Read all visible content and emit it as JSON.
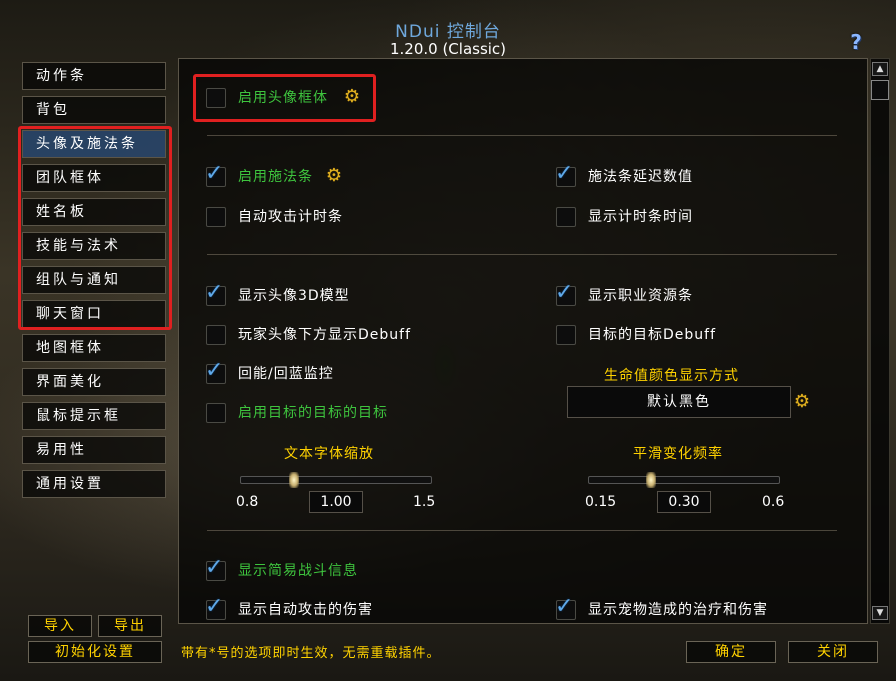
{
  "window": {
    "title": "NDui 控制台",
    "version": "1.20.0 (Classic)"
  },
  "categories": [
    {
      "label": "动作条"
    },
    {
      "label": "背包"
    },
    {
      "label": "头像及施法条"
    },
    {
      "label": "团队框体"
    },
    {
      "label": "姓名板"
    },
    {
      "label": "技能与法术"
    },
    {
      "label": "组队与通知"
    },
    {
      "label": "聊天窗口"
    },
    {
      "label": "地图框体"
    },
    {
      "label": "界面美化"
    },
    {
      "label": "鼠标提示框"
    },
    {
      "label": "易用性"
    },
    {
      "label": "通用设置"
    }
  ],
  "options": {
    "enable_unitframes": {
      "label": "启用头像框体",
      "checked": false
    },
    "enable_castbar": {
      "label": "启用施法条",
      "checked": true
    },
    "castbar_latency": {
      "label": "施法条延迟数值",
      "checked": true
    },
    "swing_timer": {
      "label": "自动攻击计时条",
      "checked": false
    },
    "show_cast_time": {
      "label": "显示计时条时间",
      "checked": false
    },
    "portrait_3d": {
      "label": "显示头像3D模型",
      "checked": true
    },
    "class_power": {
      "label": "显示职业资源条",
      "checked": true
    },
    "player_debuff": {
      "label": "玩家头像下方显示Debuff",
      "checked": false
    },
    "tot_debuff": {
      "label": "目标的目标Debuff",
      "checked": false
    },
    "energy_ticker": {
      "label": "回能/回蓝监控",
      "checked": true
    },
    "tot_of_tot": {
      "label": "启用目标的目标的目标",
      "checked": false
    },
    "simple_combat_text": {
      "label": "显示简易战斗信息",
      "checked": true
    },
    "auto_attack_damage": {
      "label": "显示自动攻击的伤害",
      "checked": true
    },
    "pet_heal_damage": {
      "label": "显示宠物造成的治疗和伤害",
      "checked": true
    }
  },
  "health_color": {
    "label": "生命值颜色显示方式",
    "selected": "默认黑色"
  },
  "sliders": {
    "font_scale": {
      "label": "文本字体缩放",
      "min": "0.8",
      "max": "1.5",
      "value": "1.00",
      "fraction": 0.28
    },
    "smooth_rate": {
      "label": "平滑变化频率",
      "min": "0.15",
      "max": "0.6",
      "value": "0.30",
      "fraction": 0.33
    }
  },
  "footer": {
    "import_label": "导入",
    "export_label": "导出",
    "reset_label": "初始化设置",
    "hint": "带有*号的选项即时生效，无需重载插件。",
    "ok_label": "确定",
    "close_label": "关闭"
  },
  "icons": {
    "gear": "gear-icon",
    "check": "check-icon",
    "help": "help-icon"
  },
  "colors": {
    "green_label": "#3ec43e",
    "gold_label": "#ffd200",
    "title_blue": "#6fa8dc",
    "highlight_red": "#e02020"
  }
}
